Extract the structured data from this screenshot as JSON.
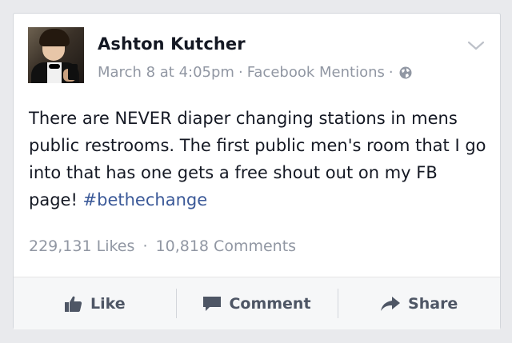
{
  "post": {
    "author": "Ashton Kutcher",
    "date": "March 8 at 4:05pm",
    "separator": "·",
    "source": "Facebook Mentions",
    "audience_icon": "globe-icon",
    "menu_icon": "chevron-down-icon",
    "text": "There are NEVER diaper changing stations in mens public restrooms. The first public men's room that I go into that has one gets a free shout out on my FB page! ",
    "hashtag": "#bethechange"
  },
  "stats": {
    "likes": "229,131 Likes",
    "comments": "10,818 Comments"
  },
  "actions": {
    "like_label": "Like",
    "like_icon": "thumbs-up-icon",
    "comment_label": "Comment",
    "comment_icon": "speech-bubble-icon",
    "share_label": "Share",
    "share_icon": "share-arrow-icon"
  },
  "colors": {
    "text_primary": "#141823",
    "text_meta": "#9197a3",
    "hashtag": "#3b5998",
    "action_text": "#4e5665",
    "action_bar_bg": "#f6f7f8"
  }
}
